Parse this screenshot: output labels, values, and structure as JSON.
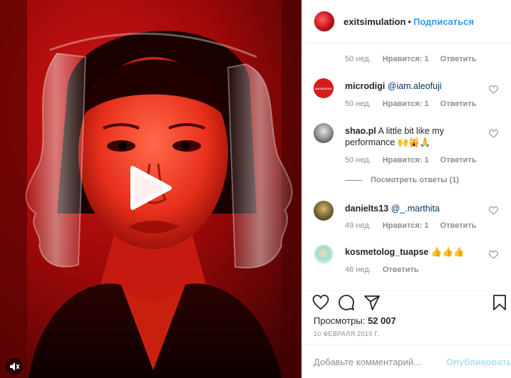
{
  "header": {
    "username": "exitsimulation",
    "separator": "•",
    "follow_label": "Подписаться"
  },
  "comments": [
    {
      "meta": {
        "age": "50 нед.",
        "likes": "Нравится: 1",
        "reply": "Ответить"
      }
    },
    {
      "username": "microdigi",
      "avatar_text": "MICRODIGI",
      "mention": "@iam.aleofuji",
      "text": "",
      "meta": {
        "age": "50 нед.",
        "likes": "Нравится: 1",
        "reply": "Ответить"
      }
    },
    {
      "username": "shao.pl",
      "mention": "",
      "text": "A little bit like my performance 🙌🙀🙏",
      "meta": {
        "age": "50 нед.",
        "likes": "Нравится: 1",
        "reply": "Ответить"
      },
      "view_replies": "Посмотреть ответы (1)"
    },
    {
      "username": "danielts13",
      "mention": "@_.marthita",
      "text": "",
      "meta": {
        "age": "49 нед.",
        "likes": "Нравится: 1",
        "reply": "Ответить"
      }
    },
    {
      "username": "kosmetolog_tuapse",
      "mention": "",
      "text": "👍👍👍",
      "meta": {
        "age": "46 нед.",
        "reply": "Ответить"
      }
    }
  ],
  "actions": {
    "like_icon": "heart-icon",
    "comment_icon": "comment-icon",
    "share_icon": "send-icon",
    "save_icon": "bookmark-icon"
  },
  "stats": {
    "views_label": "Просмотры:",
    "views_value": "52 007",
    "date": "10 ФЕВРАЛЯ 2019 Г."
  },
  "add_comment": {
    "placeholder": "Добавьте комментарий...",
    "publish_label": "Опубликовать"
  },
  "media": {
    "type": "video",
    "play_icon": "play-icon",
    "mute_icon": "speaker-icon"
  },
  "colors": {
    "accent": "#3897f0",
    "publish_disabled": "#b2dffc",
    "text_primary": "#262626",
    "text_secondary": "#8e8e8e"
  }
}
